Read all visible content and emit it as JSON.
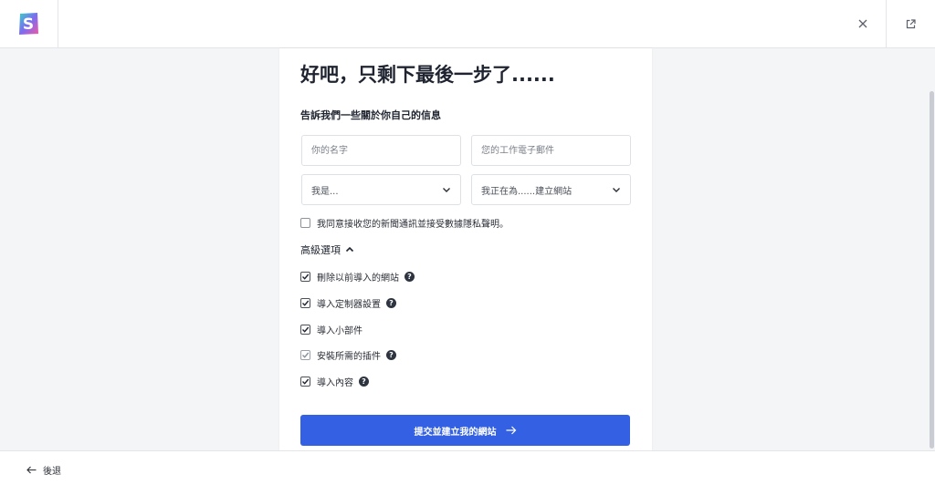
{
  "header": {
    "logo_icon": "brand-s-logo-icon",
    "close_icon": "close-icon",
    "external_icon": "external-link-icon"
  },
  "form": {
    "title": "好吧，只剩下最後一步了......",
    "section_title": "告訴我們一些關於你自己的信息",
    "name_placeholder": "你的名字",
    "email_placeholder": "您的工作電子郵件",
    "role_select": "我是...",
    "purpose_select": "我正在為......建立網站",
    "consent_label": "我同意接收您的新聞通訊並接受數據隱私聲明。",
    "consent_checked": false
  },
  "advanced": {
    "label": "高級選項",
    "expanded": true,
    "options": [
      {
        "label": "刪除以前導入的網站",
        "checked": true,
        "help": true
      },
      {
        "label": "導入定制器設置",
        "checked": true,
        "help": true
      },
      {
        "label": "導入小部件",
        "checked": true,
        "help": false
      },
      {
        "label": "安裝所需的插件",
        "checked": true,
        "help": true
      },
      {
        "label": "導入內容",
        "checked": true,
        "help": true
      }
    ]
  },
  "submit_label": "提交並建立我的網站",
  "back_label": "後退",
  "colors": {
    "primary": "#3461e3",
    "text": "#1f2430",
    "border": "#dde0e5",
    "background": "#f4f5f7"
  }
}
